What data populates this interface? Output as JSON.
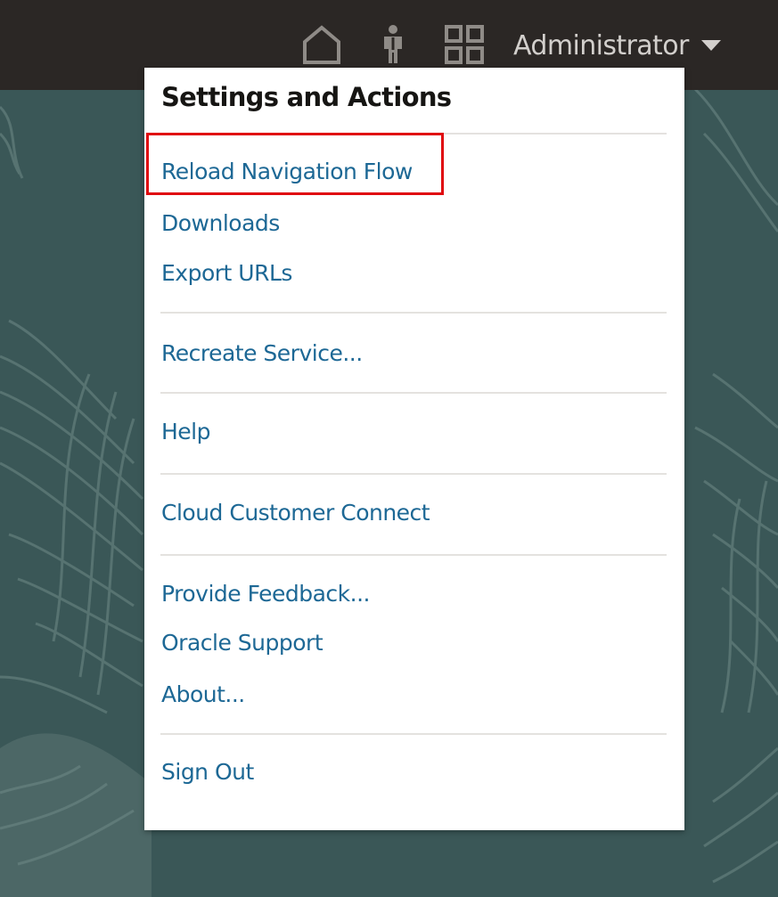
{
  "header": {
    "user_name": "Administrator",
    "icons": [
      "home-icon",
      "person-icon",
      "grid-icon",
      "caret-down-icon"
    ]
  },
  "menu": {
    "title": "Settings and Actions",
    "items": [
      {
        "label": "Reload Navigation Flow",
        "highlighted": true
      },
      {
        "label": "Downloads"
      },
      {
        "label": "Export URLs"
      },
      {
        "label": "Recreate Service..."
      },
      {
        "label": "Help"
      },
      {
        "label": "Cloud Customer Connect"
      },
      {
        "label": "Provide Feedback..."
      },
      {
        "label": "Oracle Support"
      },
      {
        "label": "About..."
      },
      {
        "label": "Sign Out"
      }
    ]
  },
  "colors": {
    "topbar": "#2b2725",
    "background": "#3b5758",
    "link": "#1d6895",
    "highlight": "#e0090e"
  }
}
